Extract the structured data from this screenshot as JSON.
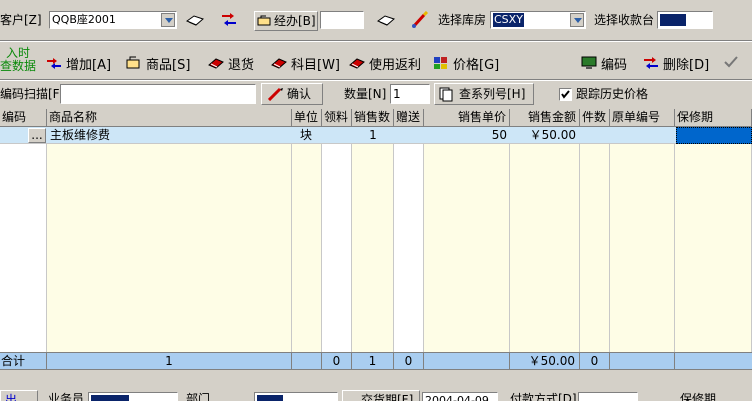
{
  "row1": {
    "customer_label": "客户[Z]",
    "customer_value": "QQB座2001",
    "handler_label": "经办[B]",
    "warehouse_label": "选择库房",
    "warehouse_value": "CSXY",
    "register_label": "选择收款台",
    "register_value": ""
  },
  "toolbar": {
    "realtime_l1": "入时",
    "realtime_l2": "查数据",
    "add": "增加[A]",
    "goods": "商品[S]",
    "return": "退货",
    "subject": "科目[W]",
    "rebate": "使用返利",
    "price": "价格[G]",
    "code": "编码",
    "delete": "删除[D]"
  },
  "row3": {
    "scan_label": "编码扫描[F]",
    "confirm": "确认",
    "qty_label": "数量[N]",
    "qty_value": "1",
    "serial": "查系列号[H]",
    "history": "跟踪历史价格"
  },
  "grid": {
    "headers": [
      "编码",
      "商品名称",
      "单位",
      "领料",
      "销售数",
      "赠送",
      "销售单价",
      "销售金额",
      "件数",
      "原单编号",
      "保修期"
    ],
    "row": {
      "code": "",
      "ellipsis": "...",
      "name": "主板维修费",
      "unit": "块",
      "qty": "1",
      "price": "50",
      "amount": "￥50.00"
    },
    "total": {
      "label": "合计",
      "count": "1",
      "pick": "0",
      "qty": "1",
      "gift": "0",
      "amount": "￥50.00",
      "pieces": "0"
    }
  },
  "bottom": {
    "left": "出",
    "staff_label": "业务员",
    "dept_label": "部门",
    "date_label": "交货期[F]",
    "date_value": "2004-04-09",
    "pay_label": "付款方式[D]",
    "warranty_label": "保修期"
  }
}
